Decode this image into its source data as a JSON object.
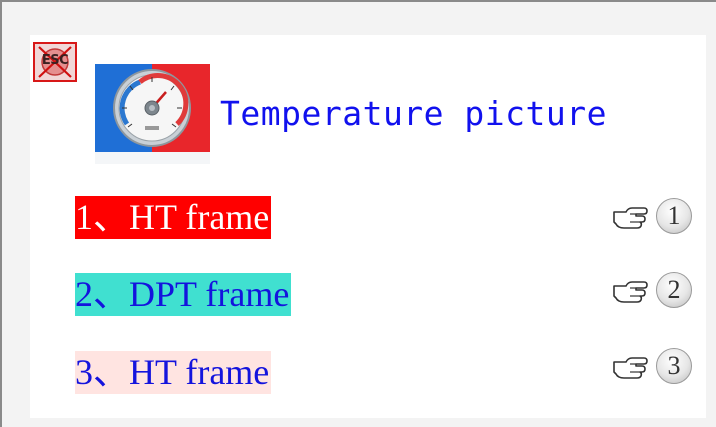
{
  "esc_button": {
    "label": "ESC",
    "icon": "esc-close-icon",
    "color": "#d81818"
  },
  "header": {
    "title": "Temperature picture",
    "image": "thermometer-dial-image"
  },
  "menu": {
    "items": [
      {
        "label": "1、HT frame",
        "background": "#ff0000",
        "text_color": "#ffffff",
        "hint_number": "1",
        "hint_icon": "pointing-hand-icon"
      },
      {
        "label": "2、DPT frame",
        "background": "#40e0d0",
        "text_color": "#1414dd",
        "hint_number": "2",
        "hint_icon": "pointing-hand-icon"
      },
      {
        "label": "3、HT frame",
        "background": "#ffe4e1",
        "text_color": "#1414dd",
        "hint_number": "3",
        "hint_icon": "pointing-hand-icon"
      }
    ]
  }
}
